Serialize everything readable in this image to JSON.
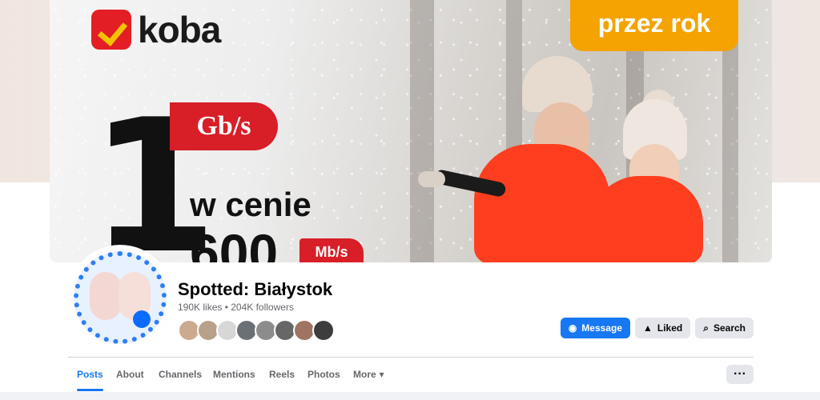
{
  "cover": {
    "brand": "koba",
    "promo": "przez rok",
    "headline_number": "1",
    "speed": "Gb/s",
    "price_text": "w cenie",
    "price_number": "600",
    "unit": "Mb/s"
  },
  "profile": {
    "title": "Spotted: Białystok",
    "stats": "190K likes • 204K followers"
  },
  "actions": {
    "message": "Message",
    "liked": "Liked",
    "search": "Search"
  },
  "tabs": {
    "posts": "Posts",
    "about": "About",
    "channels": "Channels",
    "mentions": "Mentions",
    "reels": "Reels",
    "photos": "Photos",
    "more": "More",
    "more_icon": "▾",
    "overflow": "···"
  },
  "icons": {
    "messenger": "messenger-icon",
    "like": "thumbs-up-icon",
    "search": "search-icon"
  }
}
